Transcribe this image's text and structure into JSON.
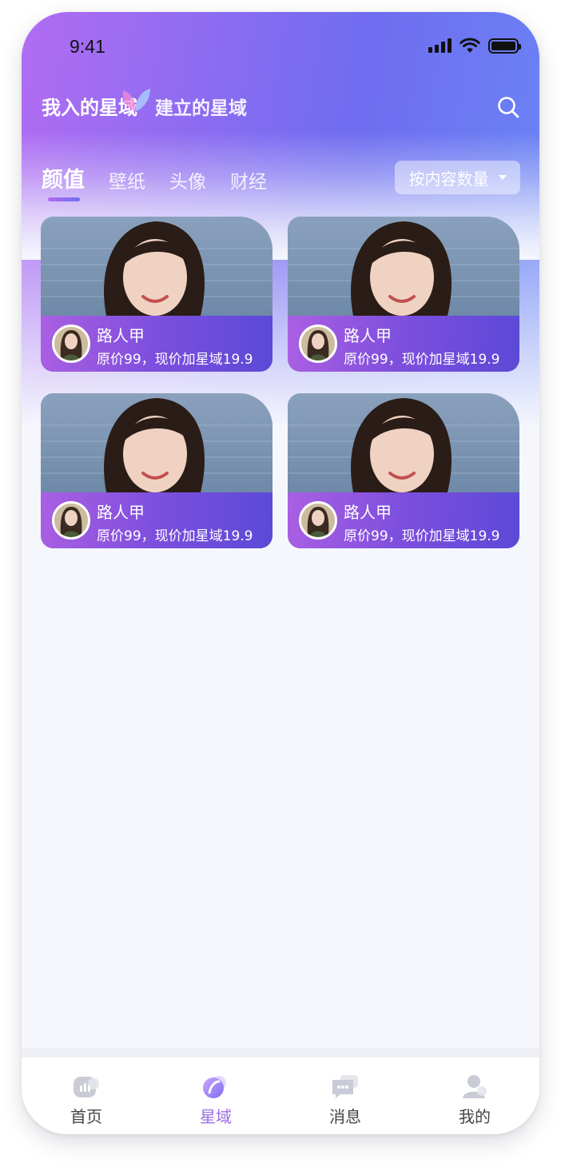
{
  "status": {
    "time": "9:41"
  },
  "header": {
    "tab_joined": "我入的星域",
    "tab_created": "建立的星域"
  },
  "categories": [
    {
      "label": "颜值",
      "active": true
    },
    {
      "label": "壁纸",
      "active": false
    },
    {
      "label": "头像",
      "active": false
    },
    {
      "label": "财经",
      "active": false
    }
  ],
  "sort": {
    "label": "按内容数量"
  },
  "cards": [
    {
      "name": "路人甲",
      "price": "原价99，现价加星域19.9"
    },
    {
      "name": "路人甲",
      "price": "原价99，现价加星域19.9"
    },
    {
      "name": "路人甲",
      "price": "原价99，现价加星域19.9"
    },
    {
      "name": "路人甲",
      "price": "原价99，现价加星域19.9"
    }
  ],
  "tabbar": [
    {
      "label": "首页",
      "icon": "home-icon",
      "active": false
    },
    {
      "label": "星域",
      "icon": "planet-icon",
      "active": true
    },
    {
      "label": "消息",
      "icon": "message-icon",
      "active": false
    },
    {
      "label": "我的",
      "icon": "profile-icon",
      "active": false
    }
  ],
  "colors": {
    "accent": "#9a6de9",
    "gradient_start": "#b16cf2",
    "gradient_end": "#6a86f5"
  }
}
